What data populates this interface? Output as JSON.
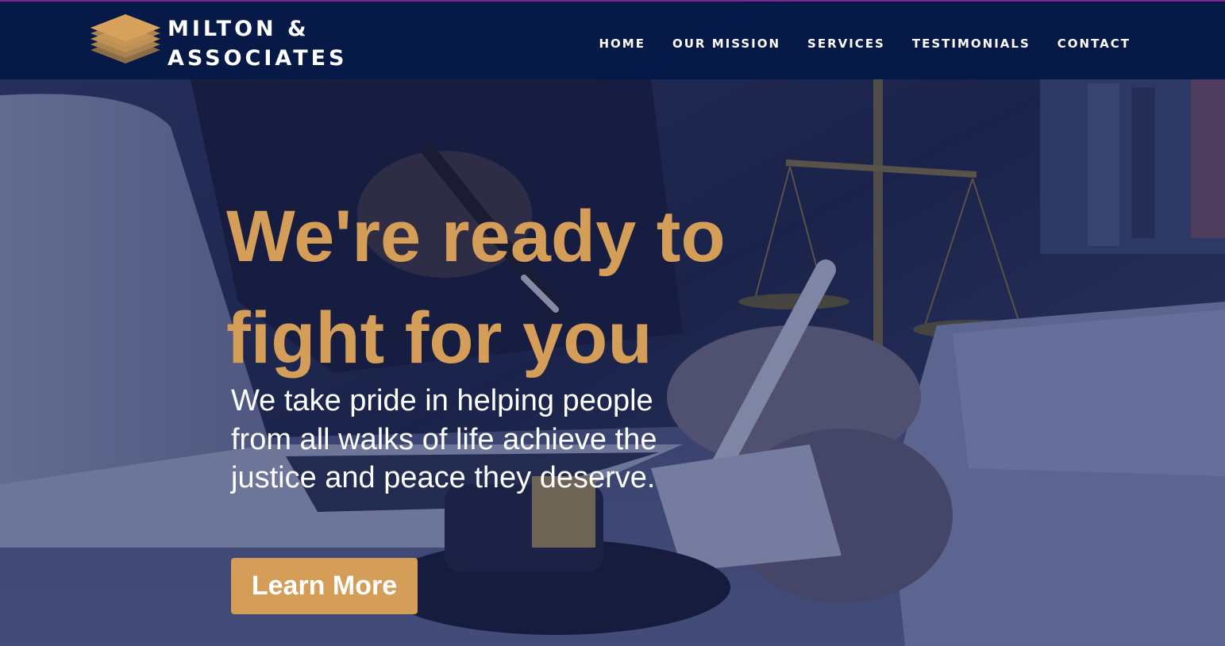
{
  "header": {
    "logo": {
      "line1": "MILTON &",
      "line2": "ASSOCIATES",
      "icon": "stacked-layers-icon"
    },
    "nav": [
      {
        "label": "HOME"
      },
      {
        "label": "OUR MISSION"
      },
      {
        "label": "SERVICES"
      },
      {
        "label": "TESTIMONIALS"
      },
      {
        "label": "CONTACT"
      }
    ]
  },
  "hero": {
    "headline": "We're ready to fight for you",
    "subtext": "We take pride in helping people from all walks of life achieve the justice and peace they deserve.",
    "cta_label": "Learn More",
    "background": "law-office-scales-of-justice-photo"
  },
  "colors": {
    "accent": "#d49d58",
    "header_bg": "#041846",
    "overlay": "#2c3560"
  }
}
